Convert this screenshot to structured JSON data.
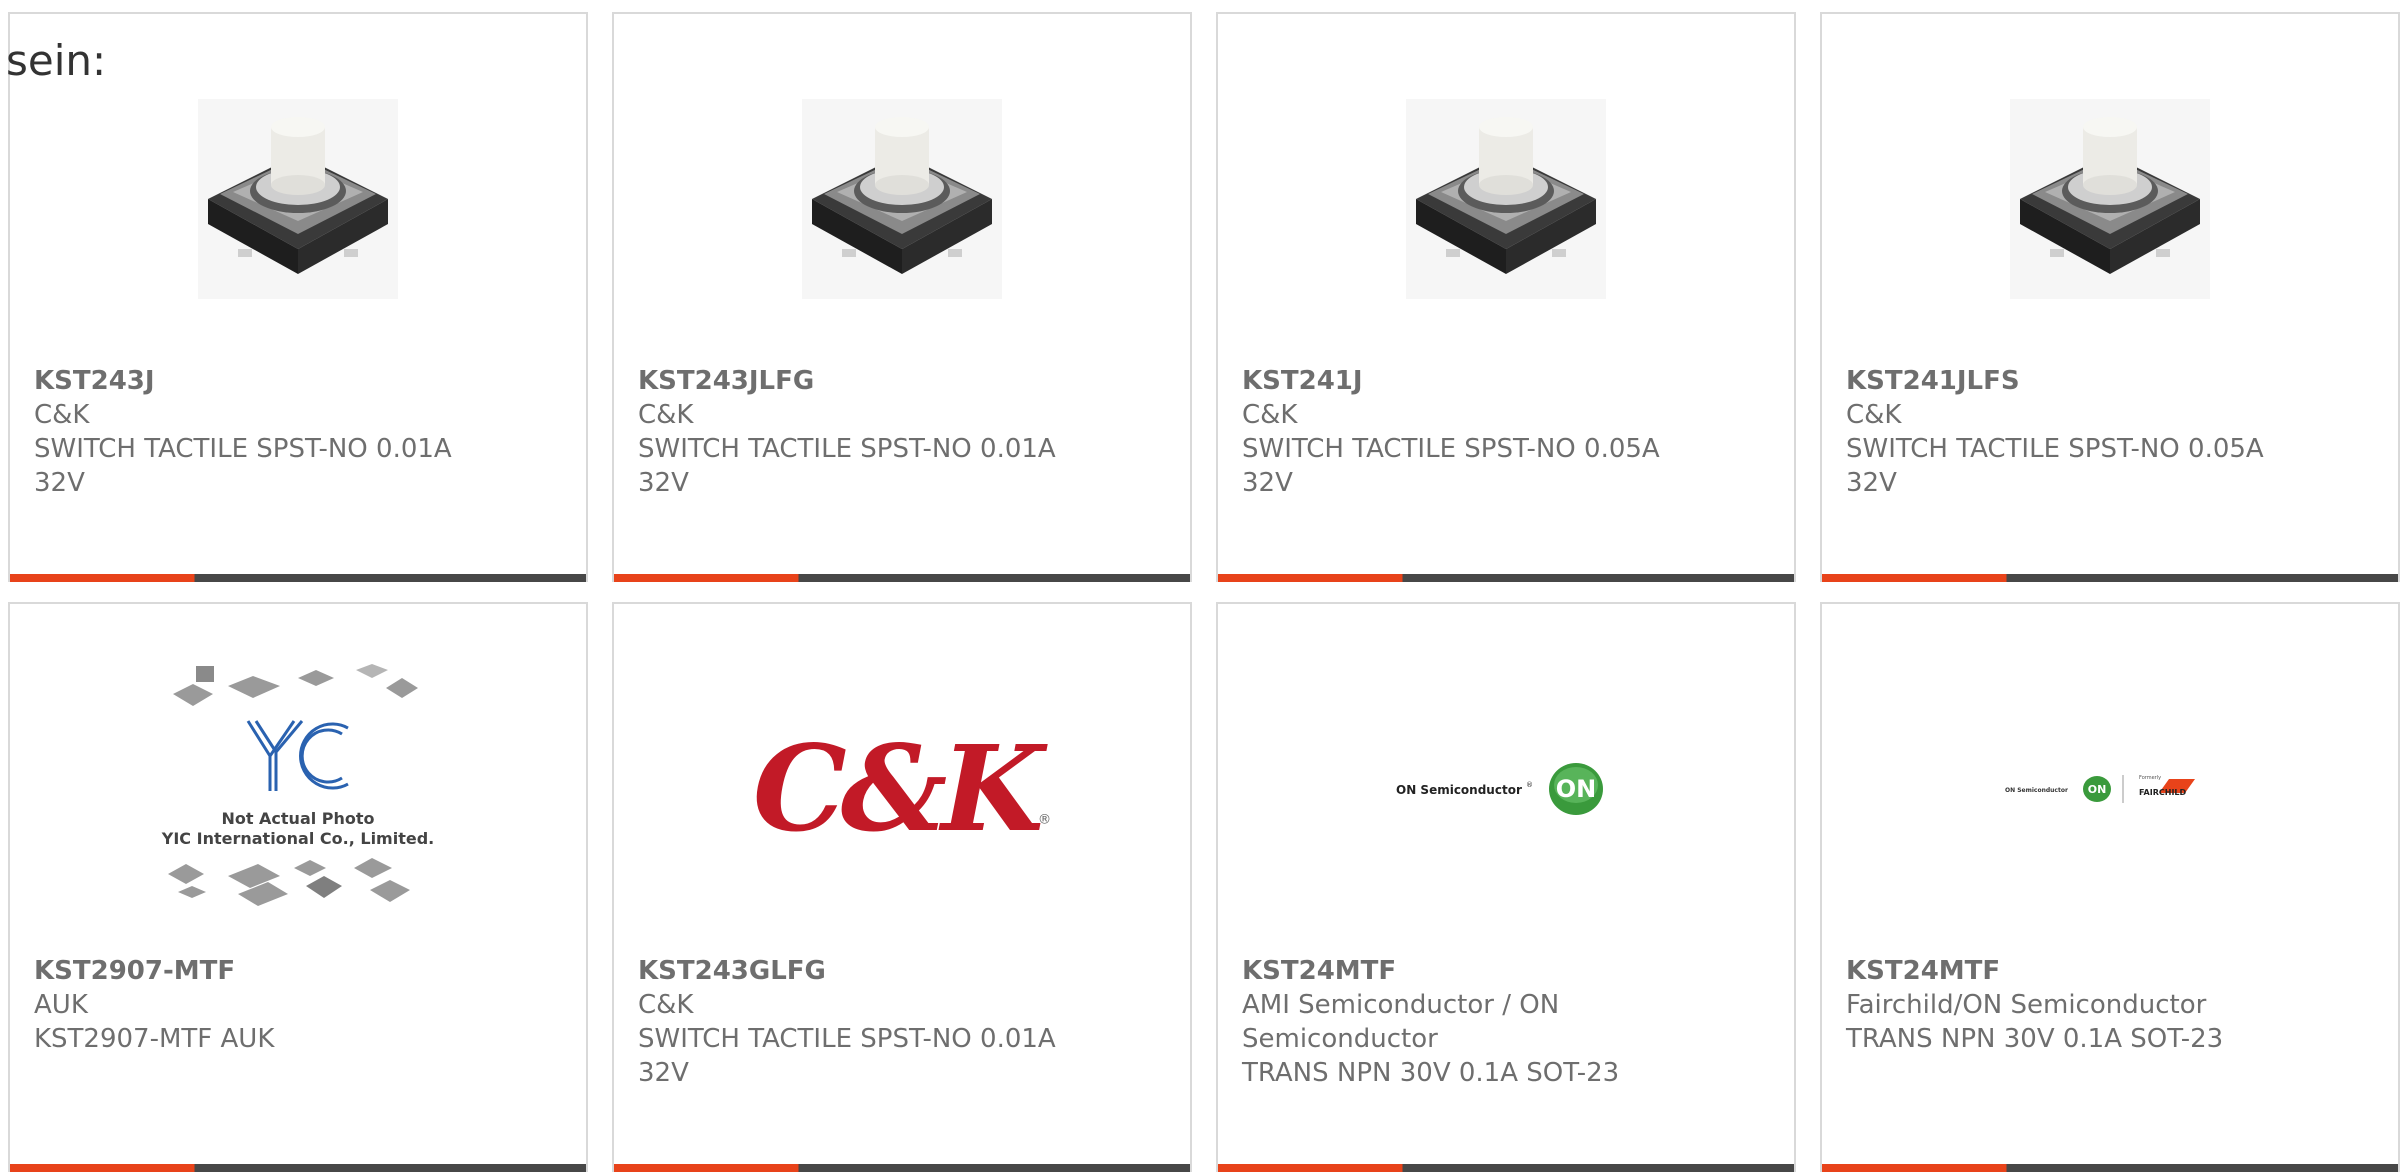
{
  "page": {
    "intro_text": "sein:"
  },
  "colors": {
    "accent": "#e8431a",
    "bar_dark": "#474747",
    "card_border": "#d9d9d9",
    "text": "#6e6e6e"
  },
  "cards": [
    {
      "part_number": "KST243J",
      "manufacturer": "C&K",
      "description": "SWITCH TACTILE SPST-NO 0.01A 32V",
      "image": "tactile-switch-photo"
    },
    {
      "part_number": "KST243JLFG",
      "manufacturer": "C&K",
      "description": "SWITCH TACTILE SPST-NO 0.01A 32V",
      "image": "tactile-switch-photo"
    },
    {
      "part_number": "KST241J",
      "manufacturer": "C&K",
      "description": "SWITCH TACTILE SPST-NO 0.05A 32V",
      "image": "tactile-switch-photo"
    },
    {
      "part_number": "KST241JLFS",
      "manufacturer": "C&K",
      "description": "SWITCH TACTILE SPST-NO 0.05A 32V",
      "image": "tactile-switch-photo"
    },
    {
      "part_number": "KST2907-MTF",
      "manufacturer": "AUK",
      "description": "KST2907-MTF AUK",
      "image": "yic-placeholder",
      "image_text": {
        "line1": "Not Actual Photo",
        "line2": "YIC International Co., Limited.",
        "logo": "YIC"
      }
    },
    {
      "part_number": "KST243GLFG",
      "manufacturer": "C&K",
      "description": "SWITCH TACTILE SPST-NO 0.01A 32V",
      "image": "ck-logo",
      "image_text": {
        "logo": "C&K",
        "mark": "®"
      }
    },
    {
      "part_number": "KST24MTF",
      "manufacturer": "AMI Semiconductor / ON Semiconductor",
      "description": "TRANS NPN 30V 0.1A SOT-23",
      "image": "on-semi-logo",
      "image_text": {
        "wordmark": "ON Semiconductor",
        "badge": "ON",
        "mark": "®"
      }
    },
    {
      "part_number": "KST24MTF",
      "manufacturer": "Fairchild/ON Semiconductor",
      "description": "TRANS NPN 30V 0.1A SOT-23",
      "image": "fairchild-on-logo",
      "image_text": {
        "wordmark": "ON Semiconductor",
        "badge": "ON",
        "formerly": "Formerly",
        "fairchild": "FAIRCHILD"
      }
    }
  ]
}
